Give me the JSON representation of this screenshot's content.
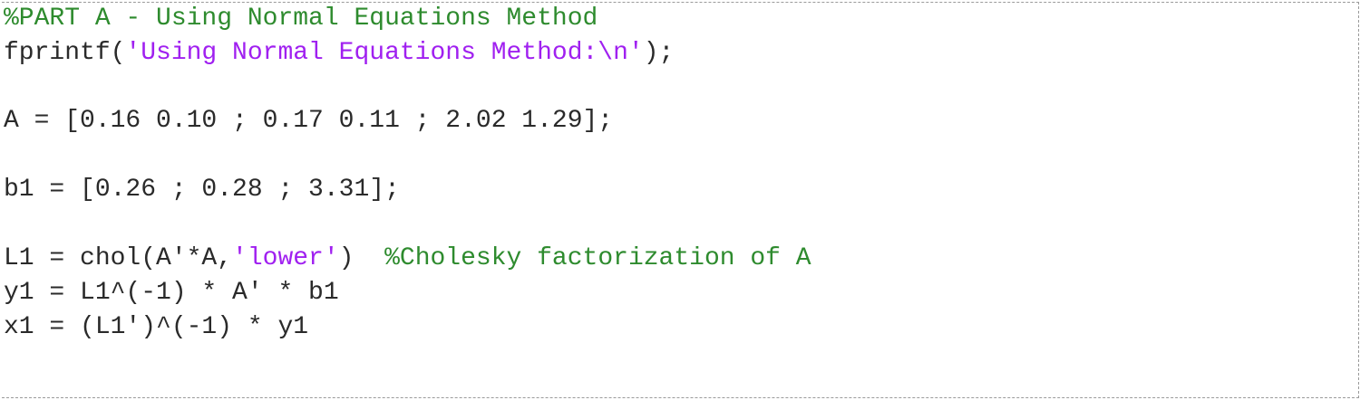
{
  "lines": [
    {
      "segments": [
        {
          "type": "comment",
          "text": "%PART A - Using Normal Equations Method"
        }
      ]
    },
    {
      "segments": [
        {
          "type": "code",
          "text": "fprintf("
        },
        {
          "type": "string",
          "text": "'Using Normal Equations Method:\\n'"
        },
        {
          "type": "code",
          "text": ");"
        }
      ]
    },
    {
      "segments": [
        {
          "type": "code",
          "text": "A = [0.16 0.10 ; 0.17 0.11 ; 2.02 1.29];"
        }
      ]
    },
    {
      "segments": [
        {
          "type": "code",
          "text": "b1 = [0.26 ; 0.28 ; 3.31];"
        }
      ]
    },
    {
      "segments": [
        {
          "type": "code",
          "text": "L1 = chol(A'*A,"
        },
        {
          "type": "string",
          "text": "'lower'"
        },
        {
          "type": "code",
          "text": ")  "
        },
        {
          "type": "comment",
          "text": "%Cholesky factorization of A"
        }
      ]
    },
    {
      "segments": [
        {
          "type": "code",
          "text": "y1 = L1^(-1) * A' * b1"
        }
      ]
    },
    {
      "segments": [
        {
          "type": "code",
          "text": "x1 = (L1')^(-1) * y1"
        }
      ]
    }
  ],
  "colors": {
    "comment": "#2e8b2e",
    "string": "#a020f0",
    "code": "#2a2a2a"
  }
}
